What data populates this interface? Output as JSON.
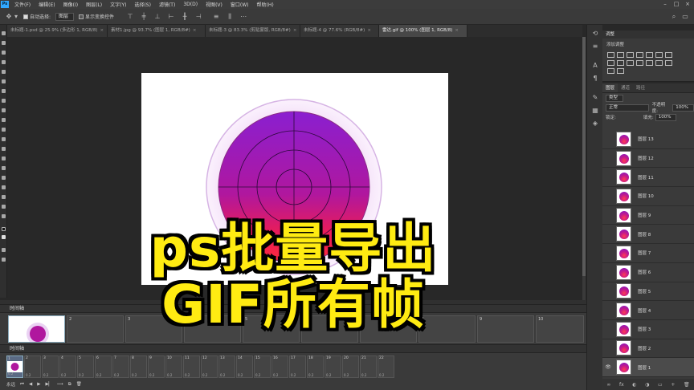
{
  "menu": {
    "logo": "Ps",
    "items": [
      "文件(F)",
      "编辑(E)",
      "图像(I)",
      "图层(L)",
      "文字(Y)",
      "选择(S)",
      "滤镜(T)",
      "3D(D)",
      "视图(V)",
      "窗口(W)",
      "帮助(H)"
    ]
  },
  "options": {
    "auto_select_label": "自动选择:",
    "layer_select": "图层",
    "show_transform_label": "显示变换控件"
  },
  "tabs": [
    {
      "label": "未标题-1.psd @ 25.9% (多边形 1, RGB/8)"
    },
    {
      "label": "素材1.jpg @ 93.7% (图层 1, RGB/8#)"
    },
    {
      "label": "未标题-3 @ 83.3% (剪贴蒙版, RGB/8#)"
    },
    {
      "label": "未标题-4 @ 77.6% (RGB/8#)"
    },
    {
      "label": "雷达.gif @ 100% (图层 1, RGB/8)"
    }
  ],
  "timeline_top": {
    "title": "时间轴",
    "frames": [
      "1",
      "2",
      "3",
      "4",
      "5",
      "6",
      "7",
      "8",
      "9",
      "10"
    ]
  },
  "timeline_bottom": {
    "title": "时间轴",
    "frames": [
      "1",
      "2",
      "3",
      "4",
      "5",
      "6",
      "7",
      "8",
      "9",
      "10",
      "11",
      "12",
      "13",
      "14",
      "15",
      "16",
      "17",
      "18",
      "19",
      "20",
      "21",
      "22"
    ],
    "frame_delay": "0.2",
    "loop_label": "永远"
  },
  "adjustments": {
    "tab_label": "调整",
    "add_label": "添加调整"
  },
  "layers": {
    "tabs": [
      "图层",
      "通道",
      "路径"
    ],
    "filter_label": "类型",
    "blend_mode": "正常",
    "opacity_label": "不透明度:",
    "opacity_value": "100%",
    "lock_label": "锁定:",
    "fill_label": "填充:",
    "fill_value": "100%",
    "list": [
      "图层 13",
      "图层 12",
      "图层 11",
      "图层 10",
      "图层 9",
      "图层 8",
      "图层 7",
      "图层 6",
      "图层 5",
      "图层 4",
      "图层 3",
      "图层 2",
      "图层 1"
    ]
  },
  "overlay": {
    "line1": "ps批量导出",
    "line2": "GIF所有帧"
  },
  "colors": {
    "overlay_text": "#ffeb12",
    "overlay_stroke": "#000000",
    "ps_accent": "#31a8ff"
  },
  "icons": {
    "move_tool": "move-icon",
    "close": "close-icon",
    "eye": "eye-icon"
  }
}
